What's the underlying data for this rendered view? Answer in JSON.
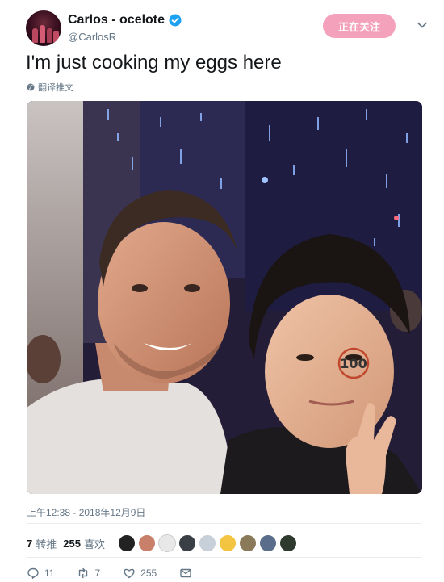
{
  "user": {
    "display_name": "Carlos - ocelote",
    "handle": "@CarlosR"
  },
  "follow_button": {
    "label": "正在关注"
  },
  "tweet": {
    "text": "I'm just cooking my eggs here",
    "translate_label": "翻译推文",
    "timestamp": "上午12:38 - 2018年12月9日"
  },
  "photo": {
    "cheek_mark": "100"
  },
  "stats": {
    "retweets_count": "7",
    "retweets_label": "转推",
    "likes_count": "255",
    "likes_label": "喜欢"
  },
  "actions": {
    "reply_count": "11",
    "retweet_count": "7",
    "like_count": "255"
  },
  "colors": {
    "follow_button": "#f4a1bb",
    "verified": "#1da1f2",
    "secondary_text": "#657786"
  },
  "icons": [
    "verified-icon",
    "chevron-down-icon",
    "globe-icon",
    "reply-icon",
    "retweet-icon",
    "heart-icon",
    "message-icon"
  ]
}
